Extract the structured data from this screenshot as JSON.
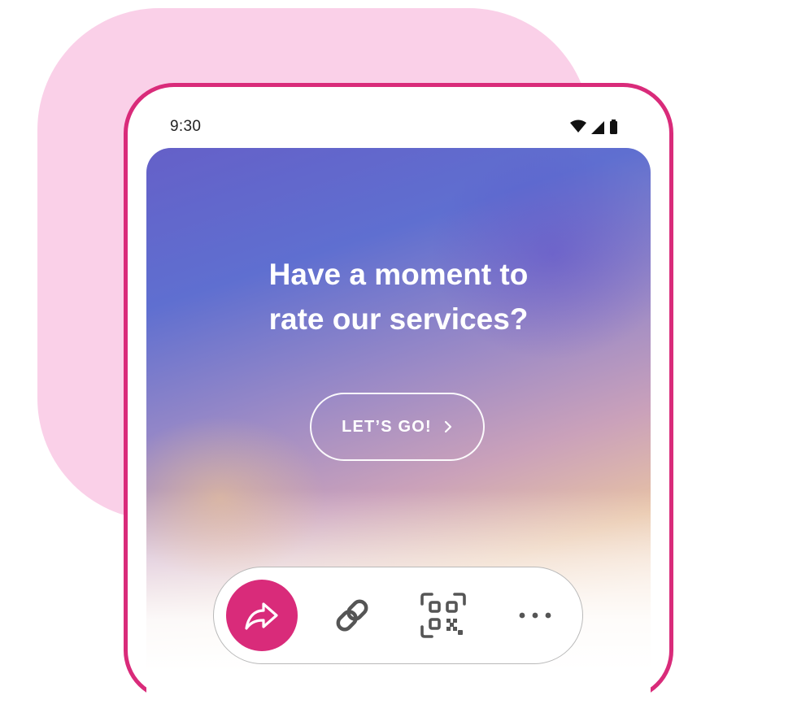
{
  "status_bar": {
    "time": "9:30",
    "icons": [
      "wifi-icon",
      "signal-icon",
      "battery-icon"
    ]
  },
  "survey_card": {
    "headline_line1": "Have a moment to",
    "headline_line2": "rate our services?",
    "cta_label": "LET’S GO!",
    "cta_icon": "chevron-right-icon"
  },
  "share_toolbar": {
    "buttons": [
      {
        "icon": "share-forward-icon"
      },
      {
        "icon": "link-icon"
      },
      {
        "icon": "qr-code-icon"
      },
      {
        "icon": "more-horizontal-icon"
      }
    ]
  },
  "colors": {
    "accent": "#d92b7a",
    "blob": "#fad0e8",
    "icon": "#555555"
  }
}
